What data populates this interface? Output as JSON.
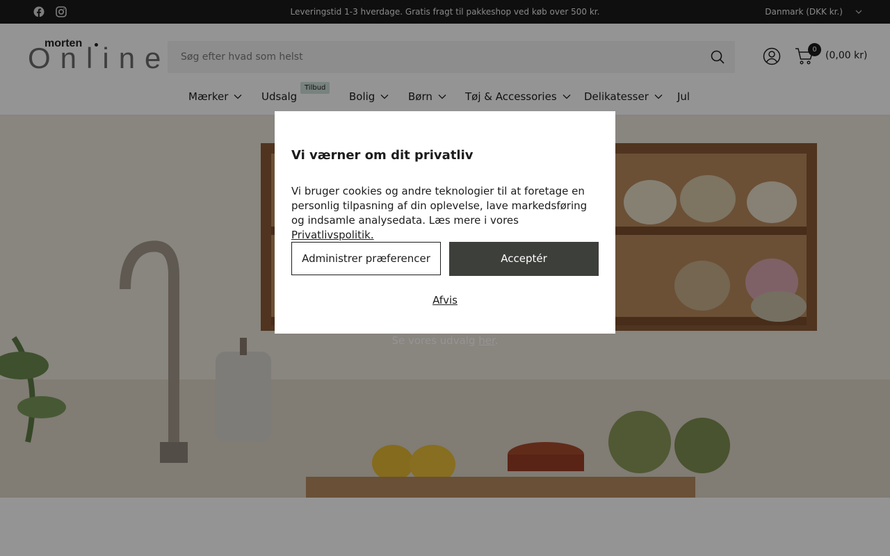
{
  "announcement": {
    "message": "Leveringstid 1-3 hverdage. Gratis fragt til pakkeshop ved køb over 500 kr.",
    "country_selector": "Danmark (DKK kr.)",
    "social_icons": [
      "facebook-icon",
      "instagram-icon"
    ]
  },
  "header": {
    "logo_small": "morten",
    "logo_big": "Online",
    "search_placeholder": "Søg efter hvad som helst",
    "cart_count": "0",
    "cart_total": "(0,00 kr)"
  },
  "nav": {
    "items": [
      {
        "label": "Mærker",
        "has_dropdown": true
      },
      {
        "label": "Udsalg",
        "has_dropdown": false,
        "tag": "Tilbud"
      },
      {
        "label": "Bolig",
        "has_dropdown": true
      },
      {
        "label": "Børn",
        "has_dropdown": true
      },
      {
        "label": "Tøj & Accessories",
        "has_dropdown": true
      },
      {
        "label": "Delikatesser",
        "has_dropdown": true
      },
      {
        "label": "Jul",
        "has_dropdown": false
      }
    ]
  },
  "hero": {
    "subtitle_prefix": "Se vores udvalg ",
    "subtitle_link": "her",
    "subtitle_suffix": "."
  },
  "cookie_modal": {
    "title": "Vi værner om dit privatliv",
    "body_text": "Vi bruger cookies og andre teknologier til at foretage en personlig tilpasning af din oplevelse, lave markedsføring og indsamle analysedata. Læs mere i vores ",
    "policy_link": "Privatlivspolitik.",
    "preferences_button": "Administrer præferencer",
    "accept_button": "Acceptér",
    "reject_button": "Afvis"
  },
  "colors": {
    "topbar_bg": "#1a1a1a",
    "accept_bg": "#3d3f3b",
    "tag_bg": "#cfe0d9"
  }
}
